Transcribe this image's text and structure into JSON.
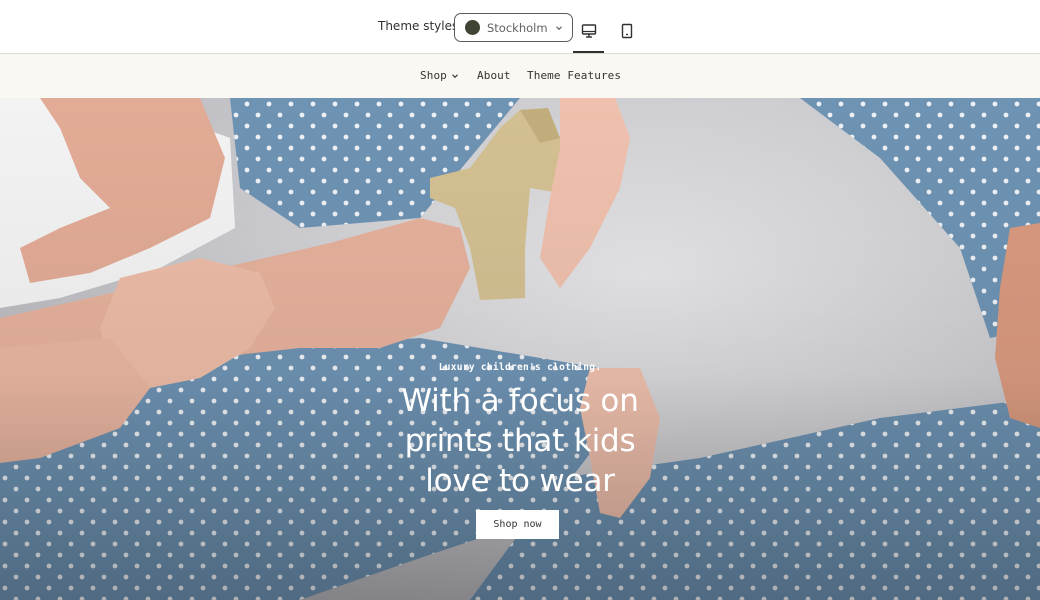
{
  "toolbar": {
    "theme_label": "Theme styles",
    "theme_select": {
      "value": "Stockholm",
      "swatch_color": "#3f4535"
    },
    "view_modes": [
      {
        "label": "desktop-icon",
        "active": true
      },
      {
        "label": "mobile-icon",
        "active": false
      }
    ]
  },
  "store_nav": {
    "items": [
      {
        "label": "Shop",
        "has_dropdown": true
      },
      {
        "label": "About",
        "has_dropdown": false
      },
      {
        "label": "Theme Features",
        "has_dropdown": false
      }
    ],
    "background": "#fbf8f3"
  },
  "hero": {
    "eyebrow": "Luxury children's clothing.",
    "title_lines": [
      "With a focus on",
      "prints that kids",
      "love to wear"
    ],
    "cta": "Shop now"
  }
}
